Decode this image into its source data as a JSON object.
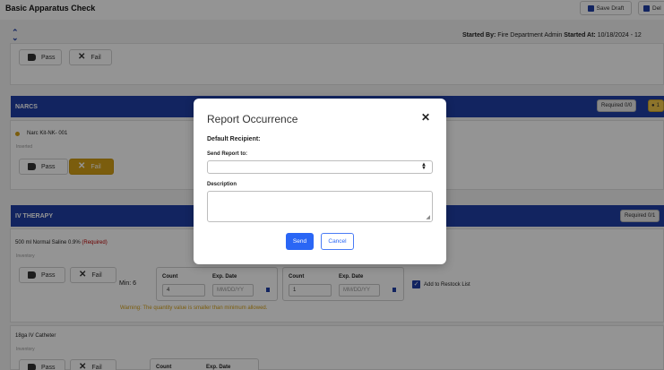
{
  "header": {
    "title": "Basic Apparatus Check",
    "save_draft_label": "Save Draft",
    "delete_label": "Del",
    "started_by_label": "Started By:",
    "started_by_value": "Fire Department Admin",
    "started_at_label": "Started At:",
    "started_at_value": "10/18/2024 - 12"
  },
  "pass_label": "Pass",
  "fail_label": "Fail",
  "narcs": {
    "title": "NARCS",
    "required_badge": "Required 0/0",
    "warn_badge": "1",
    "item_name": "Narc Kit-NK- 001",
    "item_sub": "Inserted"
  },
  "iv_therapy": {
    "title": "IV THERAPY",
    "required_badge": "Required 0/1",
    "item1_name": "500 ml Normal Saline 0.9%",
    "item1_required": "(Required)",
    "item1_sub": "Inventory",
    "min_label": "Min: 6",
    "count_label": "Count",
    "exp_label": "Exp. Date",
    "count1": "4",
    "count2": "1",
    "date_placeholder": "MM/DD/YY",
    "restock_label": "Add to Restock List",
    "warning": "Warning: The quantity value is smaller than minimum allowed.",
    "item2_name": "18ga IV Catheter",
    "item2_sub": "Inventory"
  },
  "modal": {
    "title": "Report Occurrence",
    "default_recipient": "Default Recipient:",
    "send_report_to": "Send Report to:",
    "description": "Description",
    "send_label": "Send",
    "cancel_label": "Cancel"
  }
}
